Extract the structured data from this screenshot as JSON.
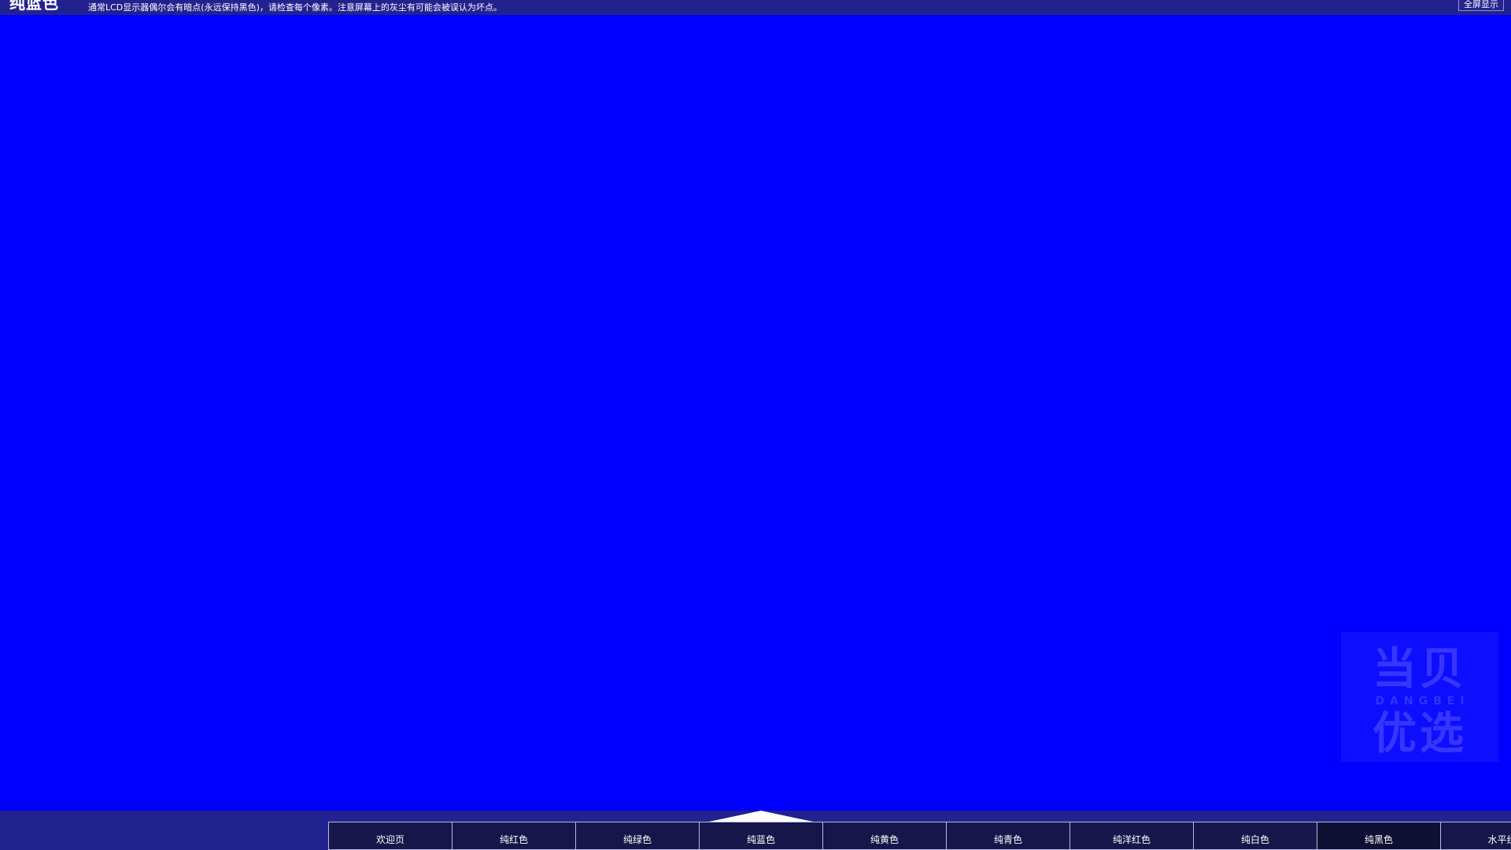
{
  "header": {
    "title": "纯蓝色",
    "description": "通常LCD显示器偶尔会有暗点(永远保持黑色)，请检查每个像素。注意屏幕上的灰尘有可能会被误认为坏点。",
    "fullscreen_label": "全屏显示",
    "background_color": "#22228f",
    "text_color": "#ffffff"
  },
  "canvas": {
    "test_color": "#0000ff",
    "test_color_name": "纯蓝色"
  },
  "watermark": {
    "brand_cn_top": "当贝",
    "brand_latin": "DANGBEI",
    "brand_cn_bottom": "优选"
  },
  "bottom_nav": {
    "background_color": "#22228f",
    "button_fill": "#16164a",
    "button_border": "#b9b9e8",
    "active_index": 3,
    "indicator_color": "#ffffff",
    "buttons": [
      {
        "label": "欢迎页",
        "state": "normal"
      },
      {
        "label": "纯红色",
        "state": "normal"
      },
      {
        "label": "纯绿色",
        "state": "normal"
      },
      {
        "label": "纯蓝色",
        "state": "active"
      },
      {
        "label": "纯黄色",
        "state": "normal"
      },
      {
        "label": "纯青色",
        "state": "normal"
      },
      {
        "label": "纯洋红色",
        "state": "normal"
      },
      {
        "label": "纯白色",
        "state": "normal"
      },
      {
        "label": "纯黑色",
        "state": "dim"
      },
      {
        "label": "水平线",
        "state": "normal"
      }
    ]
  }
}
